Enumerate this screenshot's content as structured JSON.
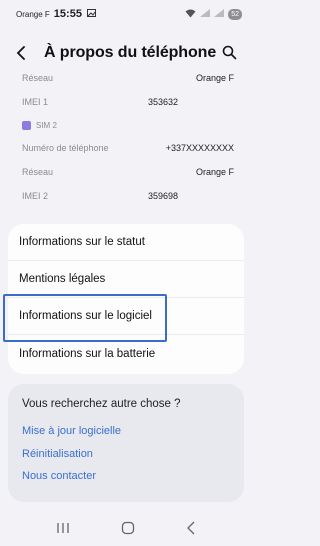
{
  "status": {
    "carrier": "Orange F",
    "time": "15:55",
    "battery": "52"
  },
  "header": {
    "title": "À propos du téléphone"
  },
  "info": {
    "network_1_label": "Réseau",
    "network_1_value": "Orange F",
    "imei1_label": "IMEI 1",
    "imei1_value": "353632",
    "sim2_label": "SIM 2",
    "phone_label": "Numéro de téléphone",
    "phone_value": "+337XXXXXXXX",
    "network_2_label": "Réseau",
    "network_2_value": "Orange F",
    "imei2_label": "IMEI 2",
    "imei2_value": "359698"
  },
  "menu": {
    "items": [
      {
        "label": "Informations sur le statut"
      },
      {
        "label": "Mentions légales"
      },
      {
        "label": "Informations sur le logiciel"
      },
      {
        "label": "Informations sur la batterie"
      }
    ]
  },
  "help": {
    "question": "Vous recherchez autre chose ?",
    "links": [
      {
        "label": "Mise à jour logicielle"
      },
      {
        "label": "Réinitialisation"
      },
      {
        "label": "Nous contacter"
      }
    ]
  },
  "colors": {
    "accent": "#3b6fd0",
    "highlight_border": "#3c6cc9",
    "background": "#f3f2f7"
  },
  "icons": [
    "back-arrow-icon",
    "search-icon",
    "sim-icon",
    "recents-icon",
    "home-icon",
    "nav-back-icon"
  ]
}
